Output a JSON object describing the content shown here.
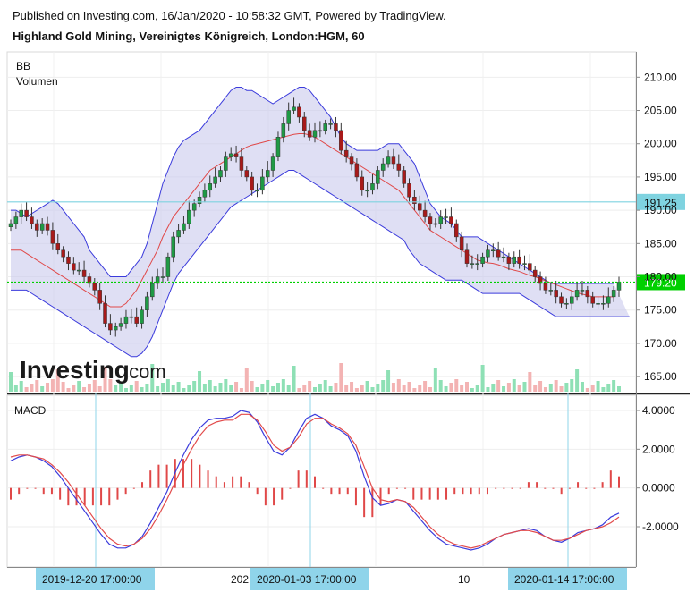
{
  "header": {
    "published": "Published on Investing.com, 16/Jan/2020 - 10:58:32 GMT, Powered by TradingView.",
    "title": "Highland Gold Mining, Vereinigtes Königreich, London:HGM, 60"
  },
  "branding": {
    "logo_text": "Investing",
    "logo_suffix": ".com"
  },
  "chart_data": [
    {
      "type": "candlestick",
      "indicators": [
        "BB",
        "Volumen"
      ],
      "ylim": [
        163,
        213
      ],
      "yticks": [
        165.0,
        170.0,
        175.0,
        180.0,
        185.0,
        190.0,
        195.0,
        200.0,
        205.0,
        210.0
      ],
      "ytick_labels": [
        "165.00",
        "170.00",
        "175.00",
        "180.00",
        "185.00",
        "190.00",
        "195.00",
        "200.00",
        "205.00",
        "210.00"
      ],
      "price_markers": [
        {
          "value": 191.25,
          "label": "191.25",
          "color": "#7fd3e0"
        },
        {
          "value": 179.2,
          "label": "179.20",
          "color": "#00d000"
        }
      ],
      "close": [
        188,
        189,
        190,
        189,
        188,
        187,
        188,
        187,
        185,
        184,
        183,
        182,
        181,
        181,
        180,
        179,
        178,
        176,
        173,
        172,
        172.5,
        173,
        174,
        174,
        173,
        175,
        177,
        179,
        180,
        180,
        183,
        186,
        187,
        188,
        190,
        191,
        192,
        193,
        194,
        195,
        196,
        198,
        198.5,
        198,
        196,
        195,
        193,
        193,
        195,
        196,
        198,
        201,
        203,
        205,
        205.5,
        204,
        202,
        201,
        202,
        202,
        203,
        203,
        202,
        199,
        198,
        197,
        195,
        193,
        193,
        194,
        196,
        197,
        198,
        197,
        196,
        194,
        192,
        191,
        190,
        189,
        188,
        188,
        189,
        189,
        188,
        186,
        184,
        182,
        182,
        182,
        183,
        184,
        184,
        183,
        183,
        182,
        183,
        182,
        182,
        181,
        180,
        179,
        178,
        178,
        177,
        176,
        176,
        177,
        178,
        178,
        177,
        176,
        176,
        176,
        177,
        178,
        179.2
      ],
      "bb_upper": [
        190,
        190,
        189.5,
        189,
        189.5,
        190,
        190.5,
        191,
        191.5,
        191,
        190,
        189,
        188,
        187,
        186,
        184,
        183,
        182,
        181,
        180,
        180,
        180,
        180,
        181,
        182,
        183,
        185,
        188,
        191,
        194,
        196,
        198,
        199.5,
        200.5,
        201,
        201.5,
        202,
        203,
        204,
        205,
        206,
        207,
        208,
        208.5,
        208.5,
        208,
        208,
        207.5,
        207,
        206.5,
        206,
        206.5,
        207,
        207.5,
        208,
        208.5,
        208.5,
        208,
        207,
        206,
        205,
        204,
        202.5,
        201,
        200,
        199.5,
        199,
        199,
        199,
        199,
        199,
        199.5,
        200,
        200,
        200,
        199,
        198,
        197,
        195,
        193,
        191,
        190,
        189,
        188.5,
        188,
        187,
        186,
        186,
        186,
        186,
        185.5,
        185,
        184.5,
        184,
        183.5,
        183,
        182.5,
        182,
        181.5,
        181,
        180.5,
        180,
        179.5,
        179,
        179,
        179,
        179,
        179,
        179,
        179,
        179,
        179,
        179,
        179,
        179,
        179
      ],
      "bb_mid": [
        184,
        184,
        184,
        183.5,
        183,
        182.5,
        182,
        181.5,
        181,
        180.5,
        180,
        179.5,
        179,
        178.5,
        178,
        177.5,
        177,
        176.5,
        176,
        175.5,
        175.5,
        175.5,
        176,
        177,
        178,
        179.5,
        181,
        182.5,
        184,
        186,
        187.5,
        189,
        190,
        191,
        192,
        193,
        194,
        195,
        196,
        196.5,
        197,
        197.5,
        198,
        198.5,
        199,
        199.5,
        199.8,
        200,
        200.2,
        200.4,
        200.6,
        200.8,
        201,
        201.2,
        201.4,
        201.5,
        201.5,
        201.3,
        201,
        200.5,
        200,
        199.5,
        199,
        198.5,
        198,
        197.5,
        197,
        196.5,
        196,
        195.5,
        195,
        194.5,
        194,
        193.5,
        193,
        192,
        191,
        190,
        189,
        188,
        187,
        186.5,
        186,
        185.5,
        185,
        184.5,
        184,
        183.5,
        183,
        182.5,
        182.3,
        182.1,
        182,
        181.8,
        181.5,
        181.2,
        181,
        180.8,
        180.5,
        180.2,
        180,
        179.7,
        179.4,
        179.1,
        178.8,
        178.5,
        178.2,
        177.9,
        177.6,
        177.4,
        177.2,
        177,
        177,
        177,
        177,
        177
      ],
      "bb_lower": [
        178,
        178,
        178,
        178,
        177.5,
        177,
        176.5,
        176,
        175.5,
        175,
        174.5,
        174,
        173.5,
        173,
        172.5,
        172,
        171.5,
        171,
        170.5,
        170,
        169.5,
        169,
        168.5,
        168,
        168,
        168.5,
        169.5,
        171,
        173,
        175,
        177,
        179,
        180.5,
        181.5,
        182.5,
        183.5,
        184.5,
        185.5,
        186.5,
        187.5,
        188.5,
        189.5,
        190.5,
        191,
        191.5,
        192,
        192.5,
        193,
        193.5,
        194,
        194.5,
        195,
        195.5,
        196,
        196,
        195.5,
        195,
        194.5,
        194,
        193.5,
        193,
        192.5,
        192,
        191.5,
        191,
        190.5,
        190,
        189.5,
        189,
        188.5,
        188,
        187.5,
        187,
        186.5,
        186,
        185.5,
        184,
        183,
        182,
        181.5,
        181,
        180.5,
        180,
        179.5,
        179.5,
        179.5,
        179.5,
        179,
        178.5,
        178,
        177.5,
        177.5,
        177.5,
        177.5,
        177.5,
        177.5,
        177.5,
        177.5,
        177,
        176.5,
        176,
        175.5,
        175,
        174.5,
        174,
        174,
        174,
        174,
        174,
        174,
        174,
        174,
        174,
        174,
        174,
        174,
        174,
        174,
        174
      ]
    },
    {
      "type": "line",
      "title": "MACD",
      "ylim": [
        -3.8,
        4.6
      ],
      "yticks": [
        -2.0,
        0.0,
        2.0,
        4.0
      ],
      "ytick_labels": [
        "-2.0000",
        "0.0000",
        "2.0000",
        "4.0000"
      ],
      "series": [
        {
          "color": "#3b3bdc",
          "values": [
            1.4,
            1.6,
            1.7,
            1.6,
            1.4,
            1.1,
            0.6,
            0.0,
            -0.6,
            -1.2,
            -1.8,
            -2.4,
            -2.9,
            -3.1,
            -3.1,
            -2.9,
            -2.5,
            -1.8,
            -1.0,
            -0.2,
            0.8,
            1.7,
            2.5,
            3.1,
            3.5,
            3.6,
            3.6,
            3.7,
            4.0,
            3.9,
            3.4,
            2.6,
            1.9,
            1.7,
            2.1,
            2.9,
            3.6,
            3.8,
            3.6,
            3.2,
            3.0,
            2.7,
            1.9,
            0.6,
            -0.5,
            -0.9,
            -0.8,
            -0.6,
            -0.7,
            -1.2,
            -1.7,
            -2.2,
            -2.6,
            -2.9,
            -3.0,
            -3.1,
            -3.2,
            -3.1,
            -2.9,
            -2.6,
            -2.4,
            -2.3,
            -2.2,
            -2.1,
            -2.2,
            -2.5,
            -2.7,
            -2.8,
            -2.6,
            -2.3,
            -2.2,
            -2.1,
            -1.9,
            -1.5,
            -1.3
          ]
        },
        {
          "color": "#e24a4a",
          "values": [
            1.6,
            1.7,
            1.7,
            1.6,
            1.5,
            1.2,
            0.8,
            0.3,
            -0.3,
            -0.9,
            -1.5,
            -2.1,
            -2.6,
            -2.9,
            -3.0,
            -2.9,
            -2.6,
            -2.1,
            -1.4,
            -0.6,
            0.3,
            1.2,
            2.0,
            2.7,
            3.2,
            3.4,
            3.5,
            3.5,
            3.8,
            3.8,
            3.5,
            2.9,
            2.2,
            1.9,
            2.1,
            2.6,
            3.3,
            3.6,
            3.6,
            3.3,
            3.1,
            2.8,
            2.2,
            1.1,
            0.0,
            -0.6,
            -0.7,
            -0.6,
            -0.7,
            -1.0,
            -1.5,
            -2.0,
            -2.4,
            -2.7,
            -2.9,
            -3.0,
            -3.1,
            -3.0,
            -2.8,
            -2.6,
            -2.4,
            -2.3,
            -2.2,
            -2.2,
            -2.3,
            -2.5,
            -2.7,
            -2.7,
            -2.6,
            -2.4,
            -2.2,
            -2.1,
            -2.0,
            -1.8,
            -1.5
          ]
        }
      ]
    }
  ],
  "xaxis": {
    "tick_labels": [
      "202",
      "10"
    ],
    "highlight_labels": [
      "2019-12-20  17:00:00",
      "2020-01-03  17:00:00",
      "2020-01-14  17:00:00"
    ]
  }
}
